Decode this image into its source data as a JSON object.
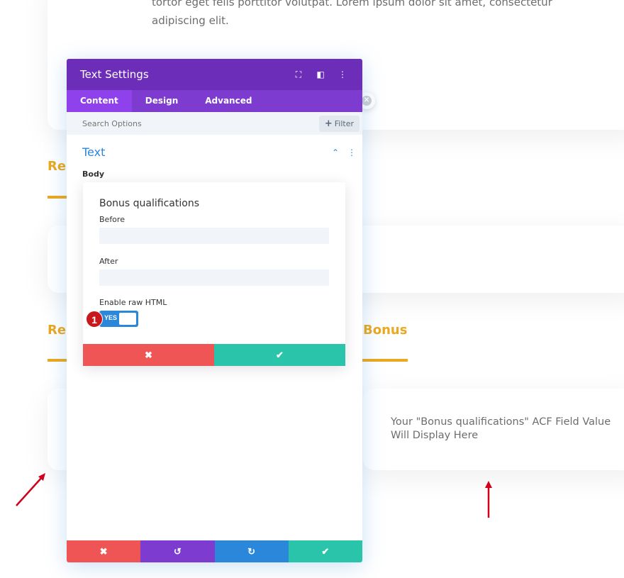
{
  "background": {
    "top_text": "tortor eget felis porttitor volutpat. Lorem ipsum dolor sit amet, consectetur adipiscing elit.",
    "heading_1": "Re",
    "heading_2": "Re",
    "heading_3": "Bonus",
    "right_card_text": "Your \"Bonus qualifications\" ACF Field Value Will Display Here",
    "close_glyph": "✕"
  },
  "modal": {
    "title": "Text Settings",
    "header_icons": [
      "focus-icon",
      "layout-icon",
      "more-icon"
    ],
    "header_glyphs": [
      "⛶",
      "◧",
      "⋮"
    ],
    "tabs": [
      "Content",
      "Design",
      "Advanced"
    ],
    "active_tab": "Content",
    "search_placeholder": "Search Options",
    "filter_label": "Filter",
    "filter_glyph": "+",
    "section_title": "Text",
    "section_glyphs": [
      "⌃",
      "⋮"
    ],
    "body_label": "Body",
    "footer_glyphs": [
      "✖",
      "↺",
      "↻",
      "✔"
    ]
  },
  "popup": {
    "title": "Bonus qualifications",
    "before_label": "Before",
    "before_value": "",
    "after_label": "After",
    "after_value": "",
    "raw_html_label": "Enable raw HTML",
    "toggle_text": "YES",
    "badge": "1",
    "cancel_glyph": "✖",
    "confirm_glyph": "✔"
  },
  "colors": {
    "purple_header": "#6c2eb9",
    "purple_tabs": "#7d3bcf",
    "accent_blue": "#2b87da",
    "red": "#ef5555",
    "green": "#29c4a9",
    "purple_button": "#7e3bd0",
    "orange": "#eca81e",
    "arrow_red": "#d0021b"
  }
}
